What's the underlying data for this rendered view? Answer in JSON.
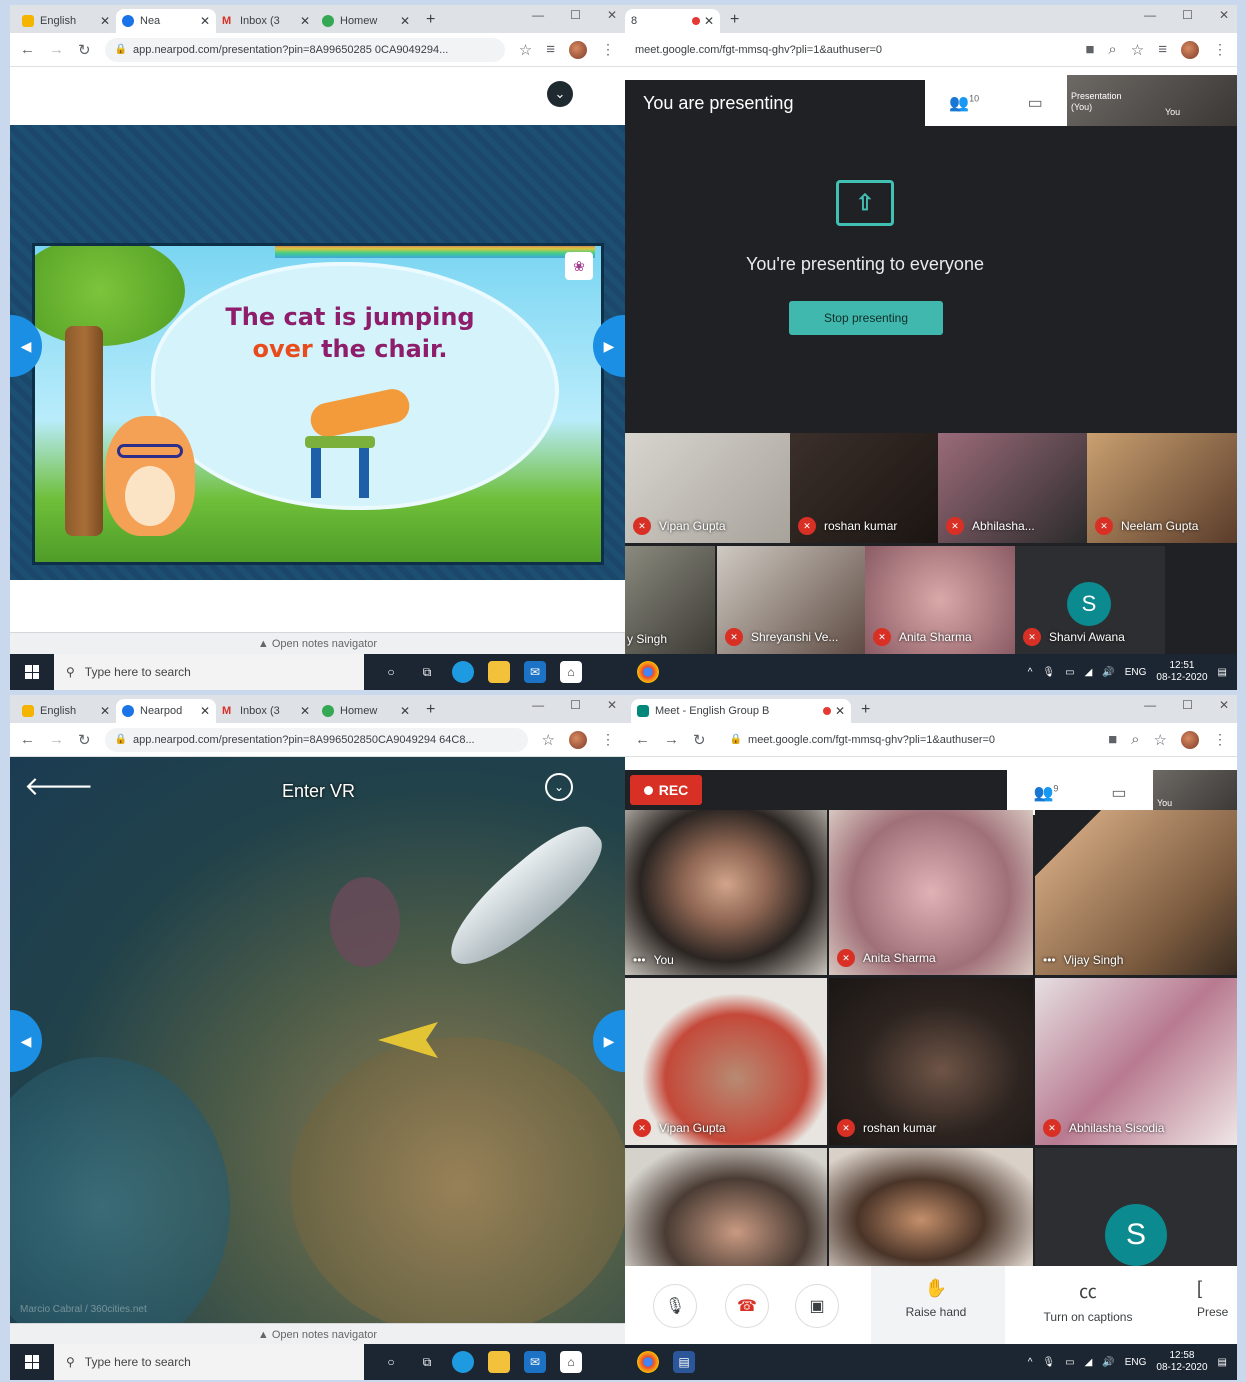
{
  "taskbar": {
    "search_placeholder": "Type here to search",
    "lang": "ENG",
    "date": "08-12-2020"
  },
  "q1": {
    "tabs": [
      {
        "label": "English",
        "color": "#f4b400"
      },
      {
        "label": "Nea",
        "color": "#1a73e8"
      },
      {
        "label": "Inbox (3",
        "color": "#d93025"
      },
      {
        "label": "Homew",
        "color": "#34a853"
      }
    ],
    "url": "app.nearpod.com/presentation?pin=8A99650285 0CA9049294...",
    "slide_line1": "The cat is jumping",
    "slide_hl": "over",
    "slide_rest": "the chair.",
    "notes_nav": "▲ Open notes navigator",
    "clock": "12:51"
  },
  "q2": {
    "tab_label": "8",
    "url": "meet.google.com/fgt-mmsq-ghv?pli=1&authuser=0",
    "presenting_title": "You are presenting",
    "people_count": "10",
    "self_label1": "Presentation (You)",
    "self_label2": "You",
    "presenting_msg": "You're presenting to everyone",
    "stop_btn": "Stop presenting",
    "participants": [
      "Vipan Gupta",
      "roshan kumar",
      "Abhilasha...",
      "Neelam Gupta",
      "y Singh",
      "Shreyanshi Ve...",
      "Anita Sharma",
      "Shanvi Awana"
    ],
    "avatar_letter": "S"
  },
  "q3": {
    "tabs": [
      {
        "label": "English",
        "color": "#f4b400"
      },
      {
        "label": "Nearpod",
        "color": "#1a73e8"
      },
      {
        "label": "Inbox (3",
        "color": "#d93025"
      },
      {
        "label": "Homew",
        "color": "#34a853"
      }
    ],
    "url": "app.nearpod.com/presentation?pin=8A996502850CA9049294 64C8...",
    "enter_vr": "Enter VR",
    "credit": "Marcio Cabral / 360cities.net",
    "notes_nav": "▲ Open notes navigator"
  },
  "q4": {
    "tab_label": "Meet - English Group B",
    "url": "meet.google.com/fgt-mmsq-ghv?pli=1&authuser=0",
    "rec": "REC",
    "people_count": "9",
    "self_label": "You",
    "participants": [
      "You",
      "Anita Sharma",
      "Vijay Singh",
      "Vipan Gupta",
      "roshan kumar",
      "Abhilasha Sisodia"
    ],
    "avatar_letter": "S",
    "raise_hand": "Raise hand",
    "captions": "Turn on captions",
    "present": "Prese",
    "clock": "12:58"
  }
}
